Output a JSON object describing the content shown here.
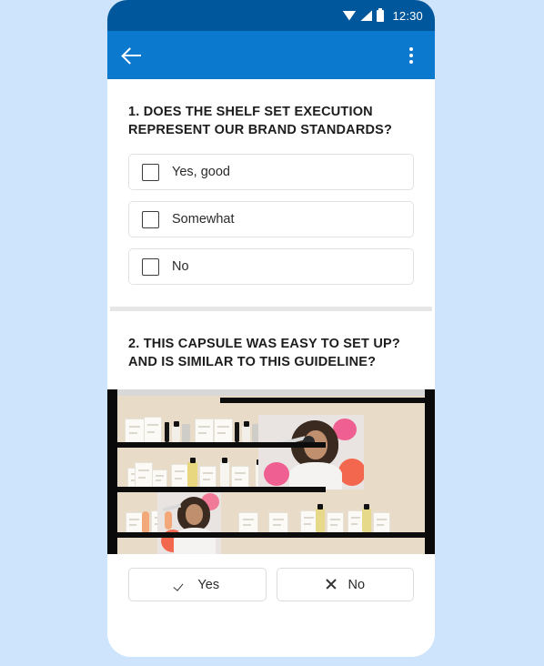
{
  "status_bar": {
    "time": "12:30",
    "icons": [
      "wifi-icon",
      "signal-icon",
      "battery-icon"
    ],
    "background_color": "#01579b"
  },
  "app_bar": {
    "back_icon": "back-arrow-icon",
    "overflow_icon": "overflow-menu-icon",
    "background_color": "#0b79ce"
  },
  "questions": [
    {
      "title": "1. DOES THE SHELF SET EXECUTION REPRESENT OUR BRAND STANDARDS?",
      "type": "checkbox-list",
      "options": [
        {
          "label": "Yes, good",
          "checked": false
        },
        {
          "label": "Somewhat",
          "checked": false
        },
        {
          "label": "No",
          "checked": false
        }
      ]
    },
    {
      "title": "2. THIS CAPSULE WAS EASY TO SET UP? AND IS SIMILAR TO THIS GUIDELINE?",
      "type": "image-yes-no",
      "image": {
        "name": "shelf-planogram-photo",
        "description": "Retail cosmetics shelf display with white product boxes, black mascara tubes and bottles on beige shelves, plus two lifestyle photos of a woman with curly hair applying makeup surrounded by pink flowers",
        "background_color": "#e8dcc8",
        "frame_color": "#0d0d0d"
      },
      "buttons": [
        {
          "label": "Yes",
          "icon": "check-icon"
        },
        {
          "label": "No",
          "icon": "x-icon"
        }
      ]
    }
  ],
  "theme": {
    "page_background": "#cde4fc",
    "card_background": "#ffffff",
    "border_color": "#e2e2e2",
    "text_color": "#2b2b2b"
  }
}
